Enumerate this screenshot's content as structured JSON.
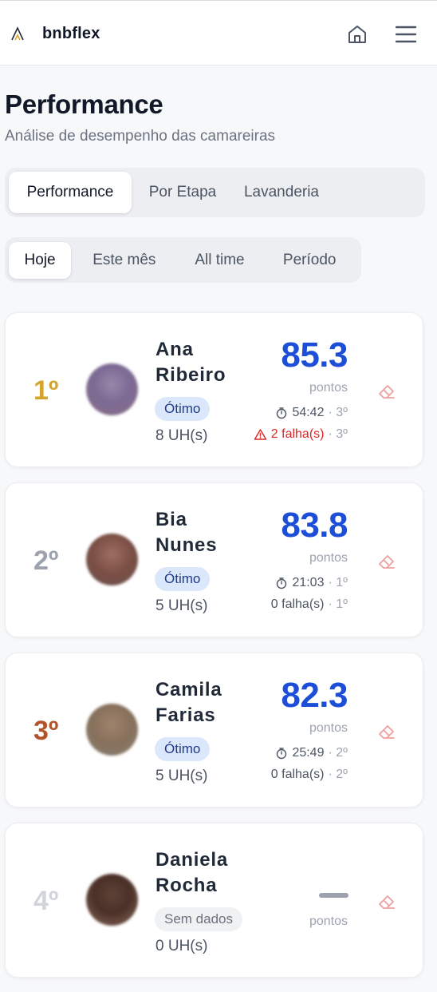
{
  "app": {
    "name": "bnbflex"
  },
  "header": {
    "title": "Performance",
    "subtitle": "Análise de desempenho das camareiras"
  },
  "tabs": [
    {
      "label": "Performance",
      "active": true
    },
    {
      "label": "Por Etapa",
      "active": false
    },
    {
      "label": "Lavanderia",
      "active": false
    }
  ],
  "periods": [
    {
      "label": "Hoje",
      "active": true
    },
    {
      "label": "Este mês",
      "active": false
    },
    {
      "label": "All time",
      "active": false
    },
    {
      "label": "Período",
      "active": false
    }
  ],
  "ranking": [
    {
      "rank": "1º",
      "first": "Ana",
      "last": "Ribeiro",
      "badge": "Ótimo",
      "uh": "8 UH(s)",
      "score": "85.3",
      "points_label": "pontos",
      "time": "54:42",
      "time_rank": "· 3º",
      "failures": "2 falha(s)",
      "failures_rank": "· 3º",
      "has_failures": true
    },
    {
      "rank": "2º",
      "first": "Bia",
      "last": "Nunes",
      "badge": "Ótimo",
      "uh": "5 UH(s)",
      "score": "83.8",
      "points_label": "pontos",
      "time": "21:03",
      "time_rank": "· 1º",
      "failures": "0 falha(s)",
      "failures_rank": "· 1º",
      "has_failures": false
    },
    {
      "rank": "3º",
      "first": "Camila",
      "last": "Farias",
      "badge": "Ótimo",
      "uh": "5 UH(s)",
      "score": "82.3",
      "points_label": "pontos",
      "time": "25:49",
      "time_rank": "· 2º",
      "failures": "0 falha(s)",
      "failures_rank": "· 2º",
      "has_failures": false
    },
    {
      "rank": "4º",
      "first": "Daniela",
      "last": "Rocha",
      "badge": "Sem dados",
      "uh": "0 UH(s)",
      "score": "",
      "points_label": "pontos"
    }
  ],
  "colors": {
    "accent": "#1d4ed8",
    "rank_gold": "#d4a42c",
    "rank_silver": "#9ca3af",
    "rank_bronze": "#b4532a",
    "rank_other": "#d1d5db",
    "failure": "#dc2626",
    "eraser": "#f0a0a0"
  }
}
